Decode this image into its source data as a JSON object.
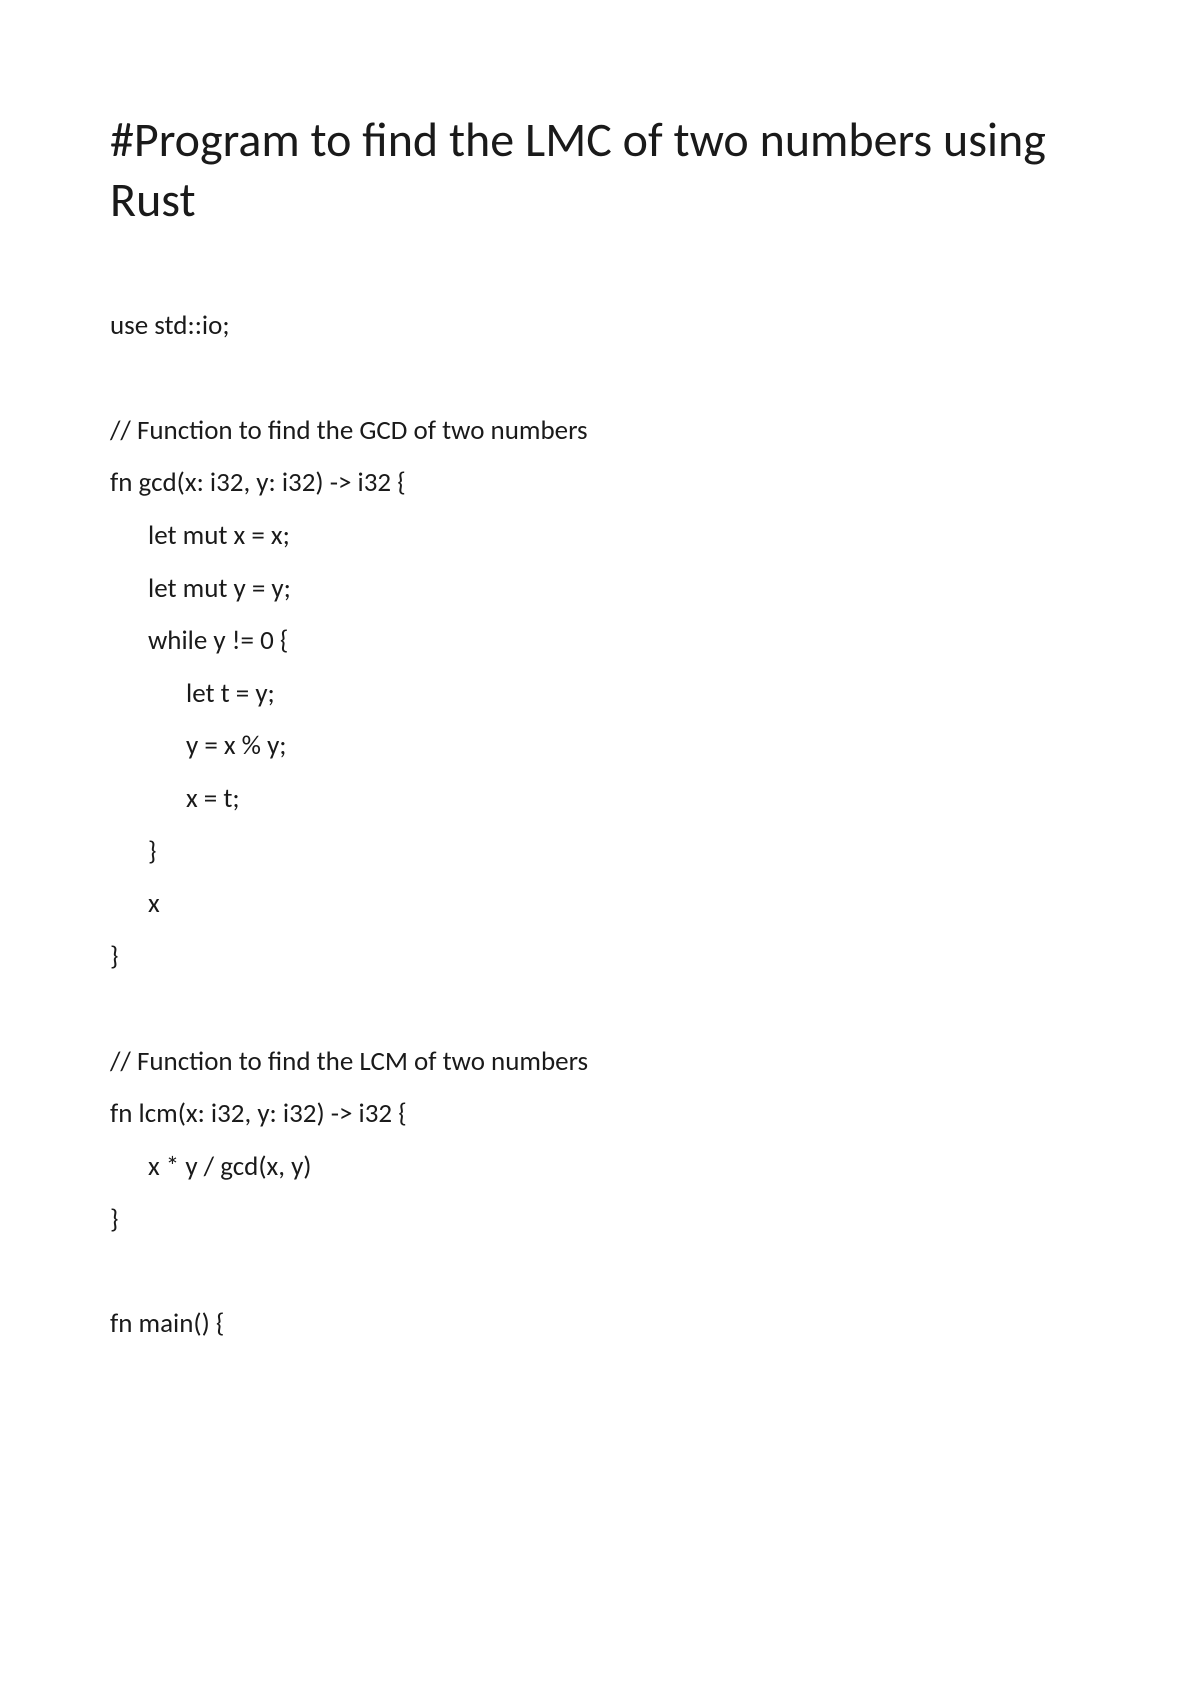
{
  "title": "#Program to find the LMC of two numbers using Rust",
  "code": {
    "l1": "use std::io;",
    "l2": "// Function to find the GCD of two numbers",
    "l3": "fn gcd(x: i32, y: i32) -> i32 {",
    "l4": "let mut x = x;",
    "l5": "let mut y = y;",
    "l6": "while y != 0 {",
    "l7": "let t = y;",
    "l8": "y = x % y;",
    "l9": "x = t;",
    "l10": "}",
    "l11": "x",
    "l12": "}",
    "l13": "// Function to find the LCM of two numbers",
    "l14": "fn lcm(x: i32, y: i32) -> i32 {",
    "l15": "x * y / gcd(x, y)",
    "l16": "}",
    "l17": "fn main() {"
  }
}
